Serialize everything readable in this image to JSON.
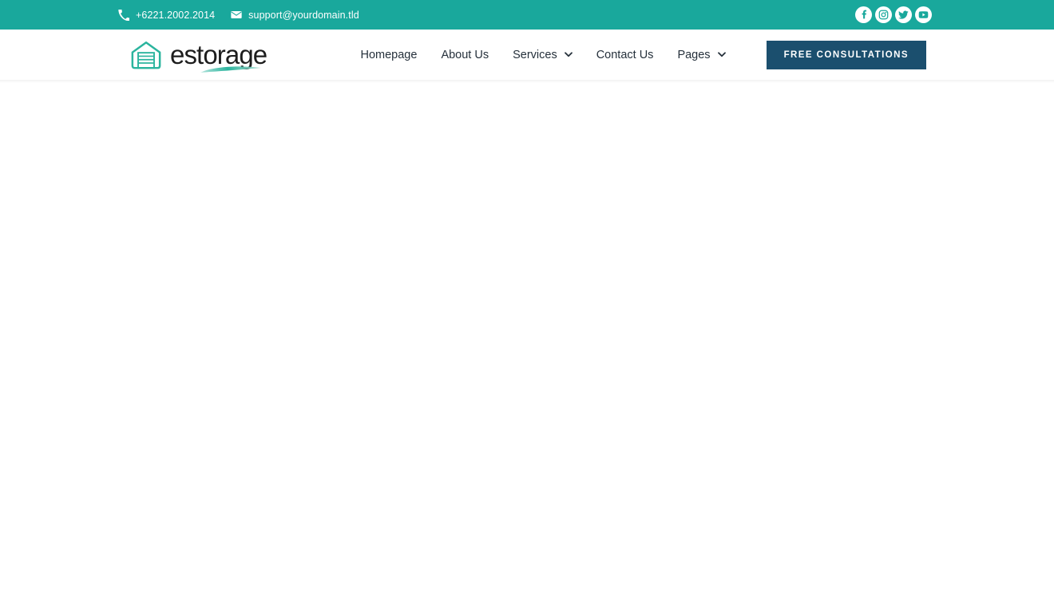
{
  "topbar": {
    "phone": {
      "icon": "phone-icon",
      "text": "+6221.2002.2014"
    },
    "email": {
      "icon": "envelope-icon",
      "text": "support@yourdomain.tld"
    },
    "social": [
      {
        "name": "facebook-icon",
        "label": "Facebook"
      },
      {
        "name": "instagram-icon",
        "label": "Instagram"
      },
      {
        "name": "twitter-icon",
        "label": "Twitter"
      },
      {
        "name": "youtube-icon",
        "label": "YouTube"
      }
    ],
    "background_color": "#19a89c",
    "text_color": "#ffffff"
  },
  "header": {
    "logo": {
      "icon": "storage-unit-icon",
      "text": "estorage",
      "text_color": "#1d1d1d",
      "accent_color": "#2bb49e"
    },
    "nav": [
      {
        "label": "Homepage",
        "has_dropdown": false
      },
      {
        "label": "About Us",
        "has_dropdown": false
      },
      {
        "label": "Services",
        "has_dropdown": true
      },
      {
        "label": "Contact Us",
        "has_dropdown": false
      },
      {
        "label": "Pages",
        "has_dropdown": true
      }
    ],
    "cta": {
      "label": "FREE CONSULTATIONS",
      "background_color": "#1b4f6e",
      "text_color": "#ffffff"
    },
    "background_color": "#ffffff"
  },
  "page": {
    "background_color": "#ffffff"
  }
}
